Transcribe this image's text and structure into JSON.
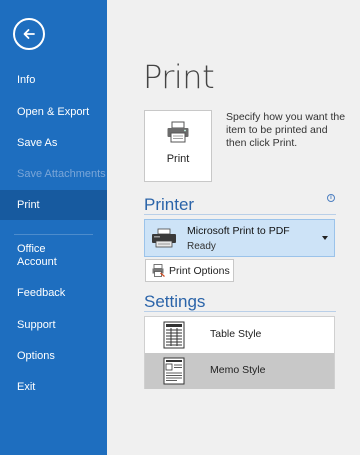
{
  "sidebar": {
    "items": [
      {
        "label": "Info",
        "state": "normal"
      },
      {
        "label": "Open & Export",
        "state": "normal"
      },
      {
        "label": "Save As",
        "state": "normal"
      },
      {
        "label": "Save Attachments",
        "state": "disabled"
      },
      {
        "label": "Print",
        "state": "selected"
      },
      {
        "label": "Office\nAccount",
        "state": "normal"
      },
      {
        "label": "Feedback",
        "state": "normal"
      },
      {
        "label": "Support",
        "state": "normal"
      },
      {
        "label": "Options",
        "state": "normal"
      },
      {
        "label": "Exit",
        "state": "normal"
      }
    ]
  },
  "main": {
    "title": "Print",
    "print_button_label": "Print",
    "print_description": "Specify how you want the item to be printed and then click Print.",
    "printer": {
      "heading": "Printer",
      "info_icon": "i",
      "selected_name": "Microsoft Print to PDF",
      "selected_status": "Ready",
      "options_label": "Print Options"
    },
    "settings": {
      "heading": "Settings",
      "styles": [
        {
          "label": "Table Style",
          "selected": false
        },
        {
          "label": "Memo Style",
          "selected": true
        }
      ]
    }
  },
  "colors": {
    "sidebar_bg": "#1e6ebf",
    "sidebar_selected": "#175a9f",
    "accent_heading": "#2b64a9",
    "printer_select_bg": "#cde3f7",
    "selected_style_bg": "#c8c8c8"
  },
  "icons": [
    "back-arrow-icon",
    "printer-icon",
    "info-icon",
    "pdf-printer-icon",
    "dropdown-caret-icon",
    "print-options-icon",
    "table-style-icon",
    "memo-style-icon"
  ]
}
